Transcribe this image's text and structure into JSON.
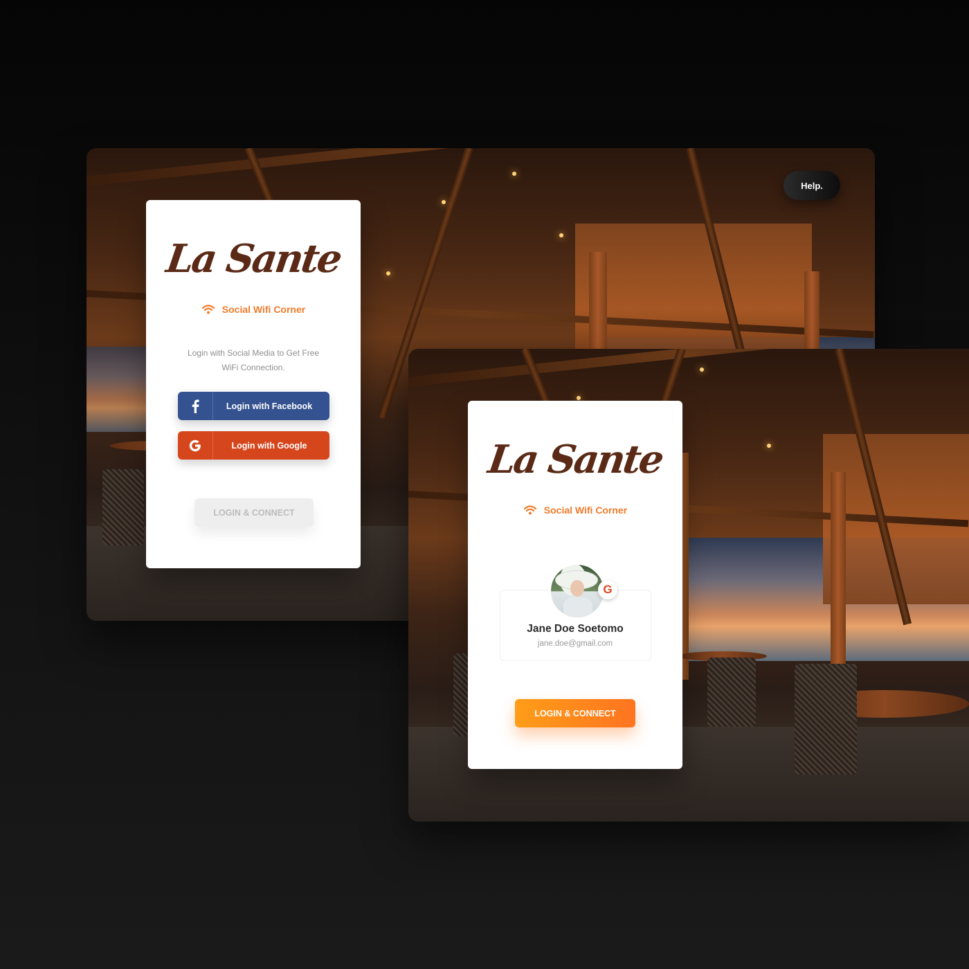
{
  "screen1": {
    "help_label": "Help.",
    "logo_text": "La Sante",
    "tagline": "Social Wifi Corner",
    "subtitle": "Login with Social Media to Get Free WiFi Connection.",
    "facebook_label": "Login with Facebook",
    "google_label": "Login with Google",
    "connect_label": "LOGIN & CONNECT",
    "connect_state": "disabled"
  },
  "screen2": {
    "logo_text": "La Sante",
    "tagline": "Social Wifi Corner",
    "profile": {
      "name": "Jane Doe Soetomo",
      "email": "jane.doe@gmail.com",
      "provider_icon": "google-icon"
    },
    "connect_label": "LOGIN & CONNECT",
    "connect_state": "enabled"
  },
  "colors": {
    "brand_brown": "#5a2a16",
    "accent_orange": "#f07a2a",
    "facebook_blue": "#33528f",
    "google_red": "#d5461d",
    "connect_gradient_start": "#ff9d18",
    "connect_gradient_end": "#ff7420"
  },
  "icons": [
    "wifi-icon",
    "facebook-icon",
    "google-icon"
  ]
}
